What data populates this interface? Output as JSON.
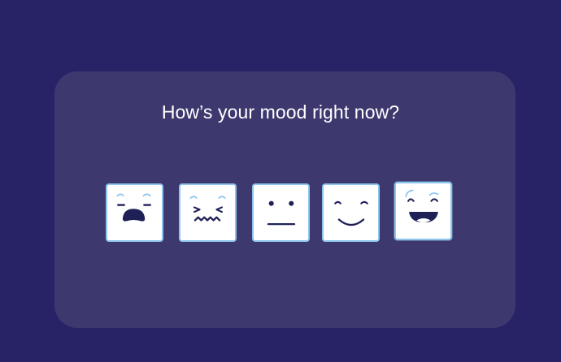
{
  "prompt": {
    "question": "How’s your mood right now?"
  },
  "moods": [
    {
      "icon": "terrified-face-icon"
    },
    {
      "icon": "distressed-face-icon"
    },
    {
      "icon": "neutral-face-icon"
    },
    {
      "icon": "smiling-face-icon"
    },
    {
      "icon": "winking-laughing-face-icon"
    }
  ],
  "colors": {
    "background": "#282366",
    "card": "#3d396f",
    "face_ink": "#1f2156",
    "accent_blue": "#8ec5ee",
    "tile": "#ffffff"
  }
}
